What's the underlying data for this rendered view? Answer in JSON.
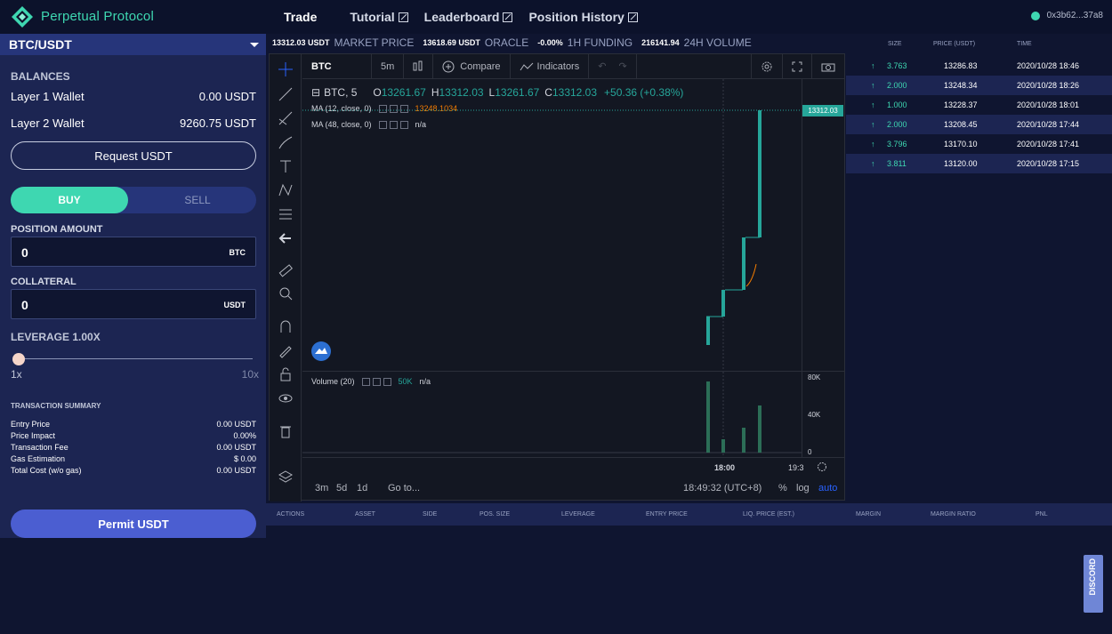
{
  "header": {
    "brand": "Perpetual Protocol",
    "nav": [
      "Trade",
      "Tutorial",
      "Leaderboard",
      "Position History"
    ],
    "wallet_address": "0x3b62...37a8"
  },
  "sidebar": {
    "pair": "BTC/USDT",
    "balances_title": "BALANCES",
    "layer1_label": "Layer 1 Wallet",
    "layer1_value": "0.00 USDT",
    "layer2_label": "Layer 2 Wallet",
    "layer2_value": "9260.75 USDT",
    "request_label": "Request USDT",
    "buy_label": "BUY",
    "sell_label": "SELL",
    "position_amount_title": "POSITION AMOUNT",
    "position_amount_value": "0",
    "position_amount_unit": "BTC",
    "collateral_title": "COLLATERAL",
    "collateral_value": "0",
    "collateral_unit": "USDT",
    "leverage_title": "LEVERAGE 1.00X",
    "slider_min": "1x",
    "slider_max": "10x",
    "summary_title": "TRANSACTION SUMMARY",
    "summary": [
      {
        "label": "Entry Price",
        "value": "0.00 USDT"
      },
      {
        "label": "Price Impact",
        "value": "0.00%"
      },
      {
        "label": "Transaction Fee",
        "value": "0.00 USDT"
      },
      {
        "label": "Gas Estimation",
        "value": "$ 0.00"
      },
      {
        "label": "Total Cost (w/o gas)",
        "value": "0.00 USDT"
      }
    ],
    "permit_label": "Permit USDT"
  },
  "stats": {
    "market_price_value": "13312.03 USDT",
    "market_price_label": "MARKET PRICE",
    "oracle_value": "13618.69 USDT",
    "oracle_label": "ORACLE",
    "funding_value": "-0.00%",
    "funding_label": "1H FUNDING",
    "volume_value": "216141.94",
    "volume_label": "24H VOLUME"
  },
  "chart": {
    "symbol": "BTC",
    "interval": "5m",
    "compare_label": "Compare",
    "indicators_label": "Indicators",
    "legend_symbol": "BTC, 5",
    "o_label": "O",
    "o_value": "13261.67",
    "h_label": "H",
    "h_value": "13312.03",
    "l_label": "L",
    "l_value": "13261.67",
    "c_label": "C",
    "c_value": "13312.03",
    "change": "+50.36 (+0.38%)",
    "ma1_label": "MA (12, close, 0)",
    "ma1_value": "13248.1034",
    "ma2_label": "MA (48, close, 0)",
    "ma2_value": "n/a",
    "price_tag": "13312.03",
    "volume_label": "Volume (20)",
    "volume_value1": "50K",
    "volume_value2": "n/a",
    "vol_axis": [
      "80K",
      "40K",
      "0"
    ],
    "time_ticks": [
      "18:00",
      "19:3"
    ],
    "ranges": [
      "3m",
      "5d",
      "1d"
    ],
    "goto_label": "Go to...",
    "clock": "18:49:32 (UTC+8)",
    "pct_label": "%",
    "log_label": "log",
    "auto_label": "auto",
    "accent_green": "#26a69a",
    "accent_orange": "#f57c00"
  },
  "trades": {
    "headers": [
      "SIZE",
      "PRICE (USDT)",
      "TIME"
    ],
    "rows": [
      {
        "size": "3.763",
        "price": "13286.83",
        "time": "2020/10/28 18:46"
      },
      {
        "size": "2.000",
        "price": "13248.34",
        "time": "2020/10/28 18:26"
      },
      {
        "size": "1.000",
        "price": "13228.37",
        "time": "2020/10/28 18:01"
      },
      {
        "size": "2.000",
        "price": "13208.45",
        "time": "2020/10/28 17:44"
      },
      {
        "size": "3.796",
        "price": "13170.10",
        "time": "2020/10/28 17:41"
      },
      {
        "size": "3.811",
        "price": "13120.00",
        "time": "2020/10/28 17:15"
      }
    ]
  },
  "positions": {
    "headers": [
      "ACTIONS",
      "ASSET",
      "SIDE",
      "POS. SIZE",
      "LEVERAGE",
      "ENTRY PRICE",
      "LIQ. PRICE (EST.)",
      "MARGIN",
      "MARGIN RATIO",
      "PNL"
    ]
  },
  "discord_label": "DISCORD"
}
